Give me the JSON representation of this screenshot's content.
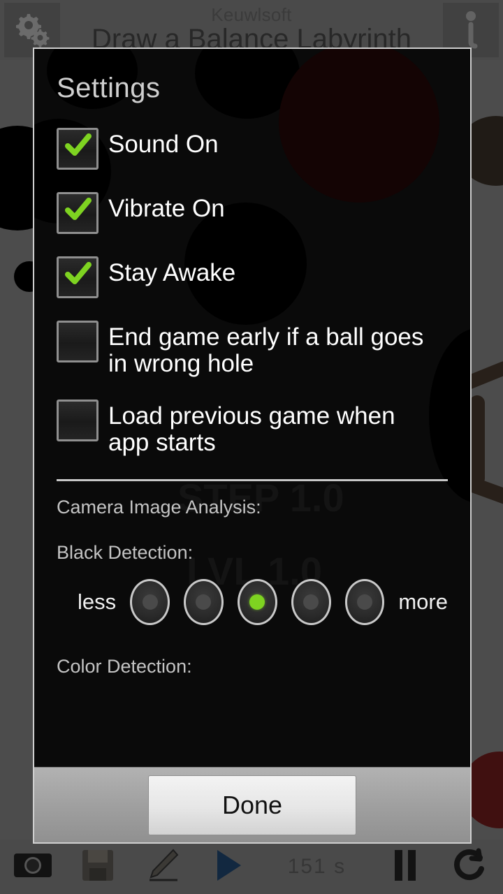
{
  "app": {
    "brand": "Keuwlsoft",
    "title": "Draw a Balance Labyrinth",
    "settings_icon": "gears-icon",
    "info_icon": "info-icon"
  },
  "game_overlay": {
    "stat_label_1": "STEP 1.0",
    "stat_label_2": "LVL 1.0"
  },
  "dialog": {
    "title": "Settings",
    "checkboxes": [
      {
        "label": "Sound On",
        "checked": true
      },
      {
        "label": "Vibrate On",
        "checked": true
      },
      {
        "label": "Stay Awake",
        "checked": true
      },
      {
        "label": "End game early if a ball goes in wrong hole",
        "checked": false
      },
      {
        "label": "Load previous game when app starts",
        "checked": false
      }
    ],
    "camera_section_label": "Camera Image Analysis:",
    "black_detection_label": "Black Detection:",
    "color_detection_label": "Color Detection:",
    "scale_less": "less",
    "scale_more": "more",
    "black_detection_options": 5,
    "black_detection_selected_index": 2,
    "done_label": "Done"
  },
  "toolbar": {
    "camera_icon": "camera-icon",
    "save_icon": "save-icon",
    "pencil_icon": "pencil-icon",
    "play_icon": "play-icon",
    "timer": "151  s",
    "pause_icon": "pause-icon",
    "reset_icon": "reset-icon"
  },
  "colors": {
    "accent_green": "#7ed321",
    "dialog_bg": "#0a0a0a",
    "chrome_gray": "#6e6e6e",
    "play_blue": "#1b3a5c"
  }
}
